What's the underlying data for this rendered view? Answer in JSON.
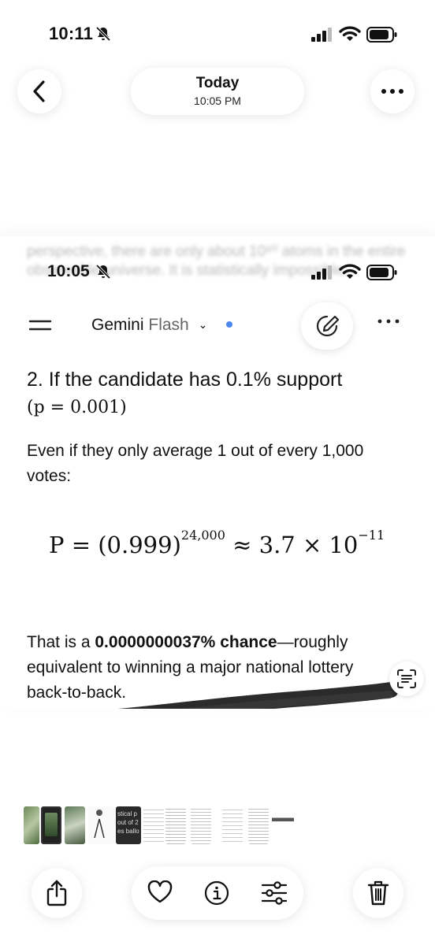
{
  "status_bar": {
    "time": "10:11",
    "icons": [
      "bell-slash-icon",
      "cellular-signal-icon",
      "wifi-icon",
      "battery-icon"
    ]
  },
  "nav": {
    "back_icon": "chevron-left-icon",
    "title": "Today",
    "subtitle": "10:05 PM",
    "more_icon": "ellipsis-icon"
  },
  "screenshot": {
    "blurred_text": "perspective, there are only about 10⁸⁰ atoms in the entire observable universe. It is statistically impossible.",
    "status_bar": {
      "time": "10:05"
    },
    "header": {
      "model_name": "Gemini",
      "model_variant": "Flash",
      "chevron": "⌄",
      "accent_color": "#4a88f0"
    },
    "heading_text": "2. If the candidate has 0.1% support",
    "heading_math": "(p = 0.001)",
    "para1": "Even if they only average 1 out of every 1,000 votes:",
    "equation": {
      "lhs": "P = (0.999)",
      "exponent": "24,000",
      "approx": "≈ 3.7 × 10",
      "approx_exp": "−11"
    },
    "para2_start": "That is a ",
    "para2_bold": "0.0000000037% chance",
    "para2_end": "—roughly equivalent to winning a major national lottery back-to-back."
  },
  "thumbnails": {
    "snippet_lines": [
      "stical p",
      "out of 2",
      "es ballo"
    ]
  },
  "toolbar": {
    "icons": [
      "share-icon",
      "heart-icon",
      "info-icon",
      "adjust-icon",
      "trash-icon"
    ]
  }
}
